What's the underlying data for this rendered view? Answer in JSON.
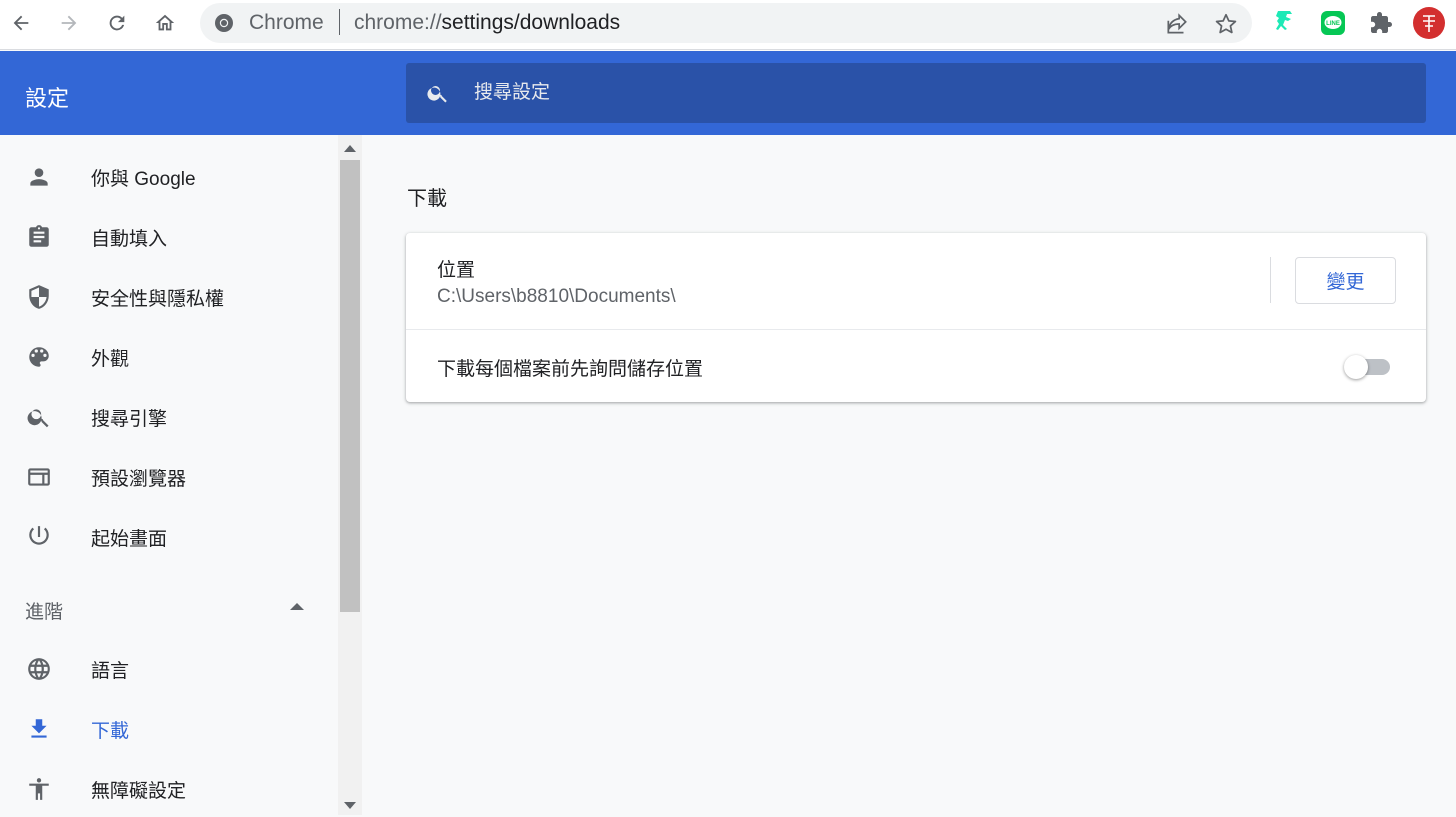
{
  "browser": {
    "omnibox": {
      "site_name": "Chrome",
      "url_scheme": "chrome://",
      "url_rest": "settings/downloads"
    }
  },
  "header": {
    "title": "設定",
    "search": {
      "placeholder": "搜尋設定"
    }
  },
  "sidebar": {
    "items": [
      {
        "label": "你與 Google",
        "icon": "person-icon"
      },
      {
        "label": "自動填入",
        "icon": "clipboard-icon"
      },
      {
        "label": "安全性與隱私權",
        "icon": "shield-icon"
      },
      {
        "label": "外觀",
        "icon": "palette-icon"
      },
      {
        "label": "搜尋引擎",
        "icon": "search-icon"
      },
      {
        "label": "預設瀏覽器",
        "icon": "browser-window-icon"
      },
      {
        "label": "起始畫面",
        "icon": "power-icon"
      }
    ],
    "advanced_label": "進階",
    "advanced_items": [
      {
        "label": "語言",
        "icon": "globe-icon"
      },
      {
        "label": "下載",
        "icon": "download-icon",
        "active": true
      },
      {
        "label": "無障礙設定",
        "icon": "accessibility-icon"
      }
    ]
  },
  "main": {
    "section_title": "下載",
    "location": {
      "label": "位置",
      "path": "C:\\Users\\b8810\\Documents\\",
      "change_button": "變更"
    },
    "ask_where_to_save": {
      "label": "下載每個檔案前先詢問儲存位置",
      "enabled": false
    }
  },
  "colors": {
    "accent": "#3367d6",
    "header_bg": "#3367d6",
    "search_bg": "#2a52a8",
    "page_bg": "#f8f9fa"
  }
}
